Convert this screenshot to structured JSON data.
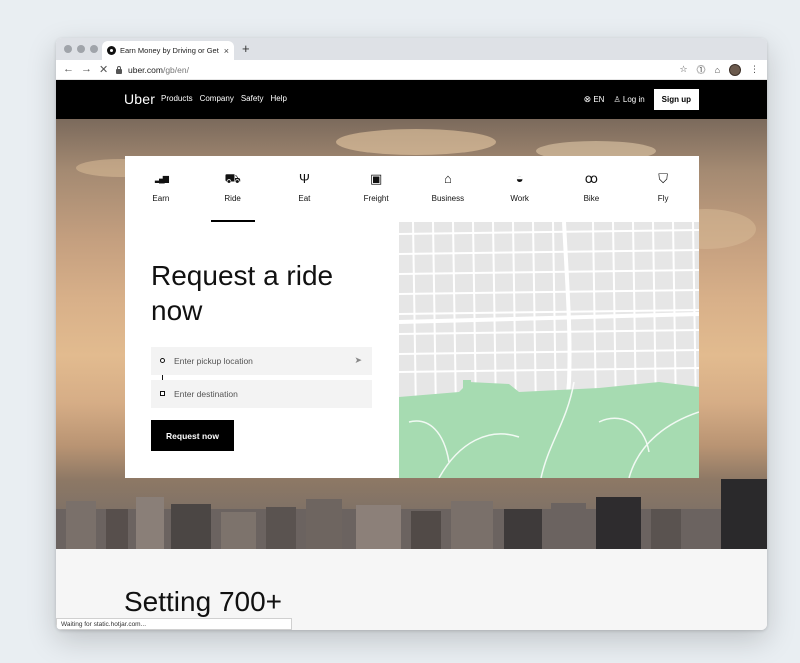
{
  "browser": {
    "tab_title": "Earn Money by Driving or Get a Ri",
    "tab_close": "×",
    "new_tab": "+",
    "url_host": "uber.com",
    "url_path": "/gb/en/",
    "back": "←",
    "forward": "→",
    "reload": "✕",
    "star": "☆",
    "ext1": "⓵",
    "ext2": "⌂",
    "menu": "⋮",
    "status": "Waiting for static.hotjar.com..."
  },
  "nav": {
    "logo": "Uber",
    "links": [
      "Products",
      "Company",
      "Safety",
      "Help"
    ],
    "lang": "EN",
    "login": "Log in",
    "signup": "Sign up"
  },
  "services": [
    {
      "label": "Earn",
      "icon": "bar-chart-icon",
      "glyph": "▂▄▆"
    },
    {
      "label": "Ride",
      "icon": "car-icon",
      "glyph": "⛟"
    },
    {
      "label": "Eat",
      "icon": "fork-knife-icon",
      "glyph": "Ψ"
    },
    {
      "label": "Freight",
      "icon": "truck-icon",
      "glyph": "▣"
    },
    {
      "label": "Business",
      "icon": "briefcase-icon",
      "glyph": "⌂"
    },
    {
      "label": "Work",
      "icon": "helmet-icon",
      "glyph": "◒"
    },
    {
      "label": "Bike",
      "icon": "bike-icon",
      "glyph": "ꝏ"
    },
    {
      "label": "Fly",
      "icon": "helicopter-icon",
      "glyph": "⛉"
    }
  ],
  "active_service": "Ride",
  "form": {
    "headline": "Request a ride now",
    "pickup_placeholder": "Enter pickup location",
    "destination_placeholder": "Enter destination",
    "button": "Request now"
  },
  "section_heading": "Setting 700+",
  "colors": {
    "brand": "#000000",
    "map_park": "#a6dbb1",
    "map_bg": "#e8e8e8"
  }
}
